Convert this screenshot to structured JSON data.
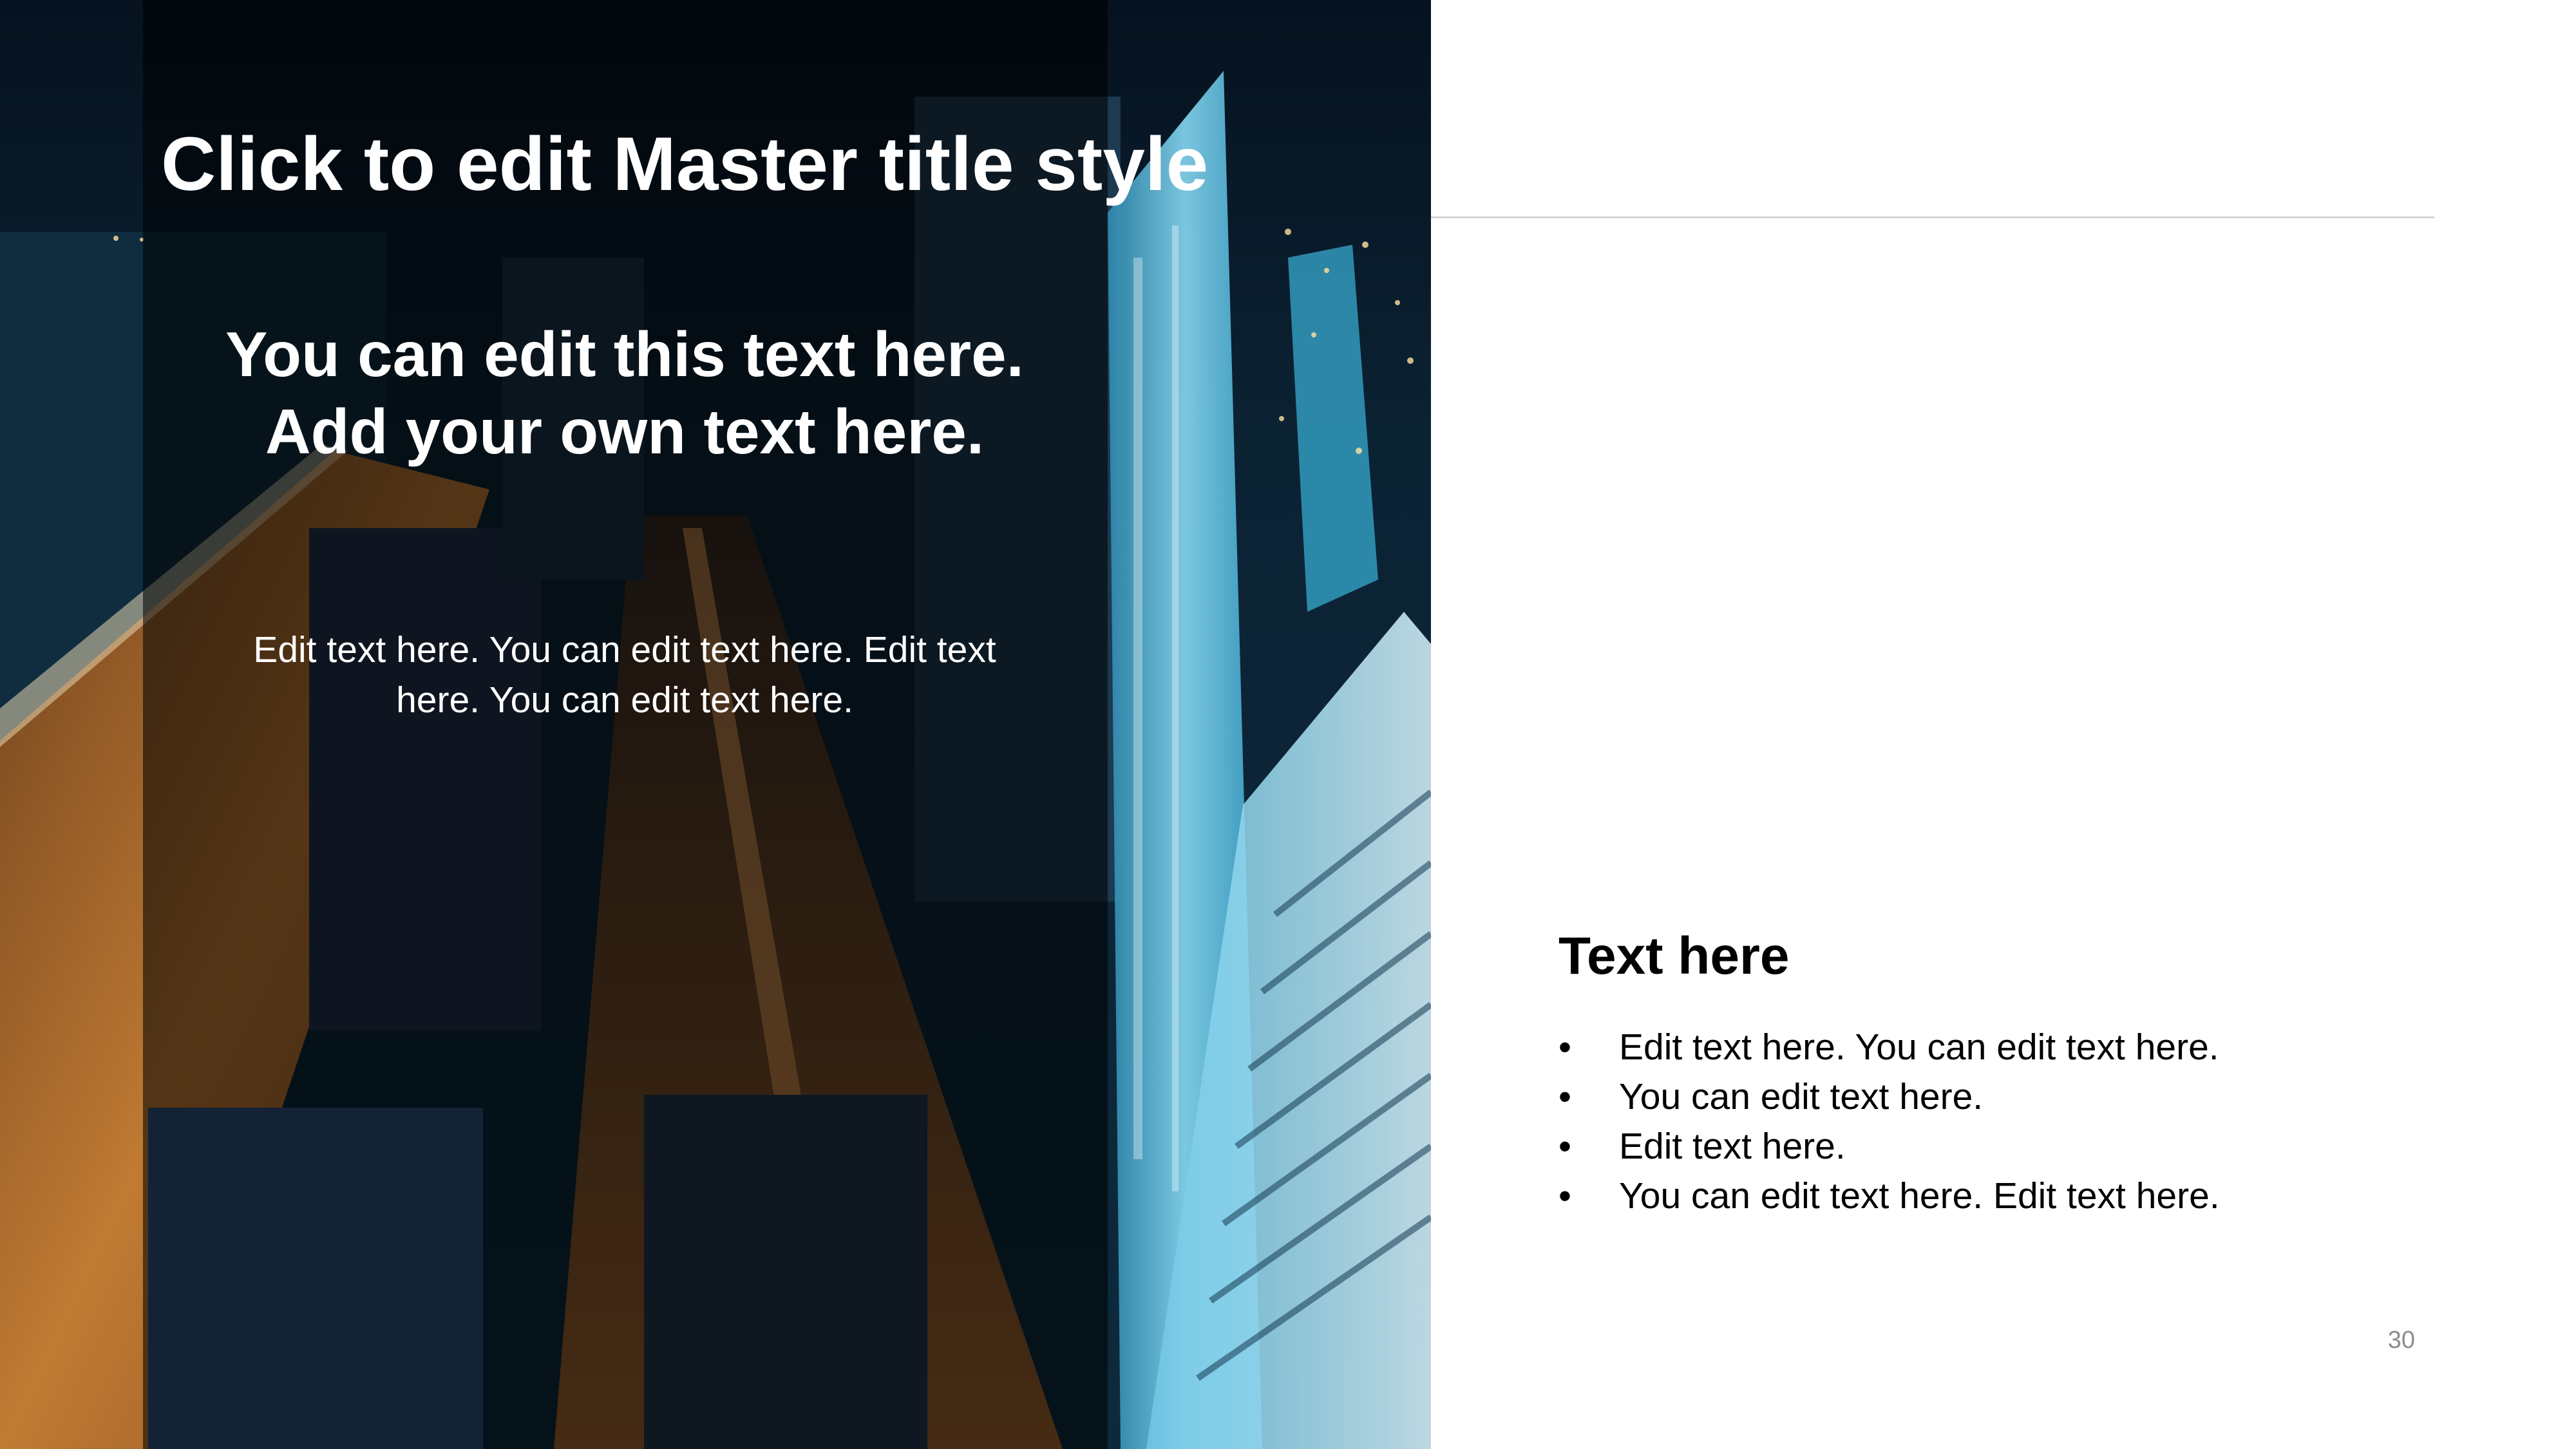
{
  "slide": {
    "master_title": "Click to edit Master title style",
    "overlay_heading": "You can edit this text here. Add your own text here.",
    "overlay_body": "Edit text here. You can edit text here. Edit text here. You can edit text here.",
    "content_heading": "Text here",
    "bullet_symbol": "•",
    "bullets": [
      "Edit text here. You can edit text here.",
      "You can edit text here.",
      "Edit text here.",
      "You can edit text here. Edit text here."
    ],
    "page_number": "30"
  },
  "colors": {
    "overlay": "#000000",
    "title_text": "#ffffff",
    "body_text": "#000000",
    "rule": "#d4d4d4",
    "page_number": "#8c8c8c"
  }
}
